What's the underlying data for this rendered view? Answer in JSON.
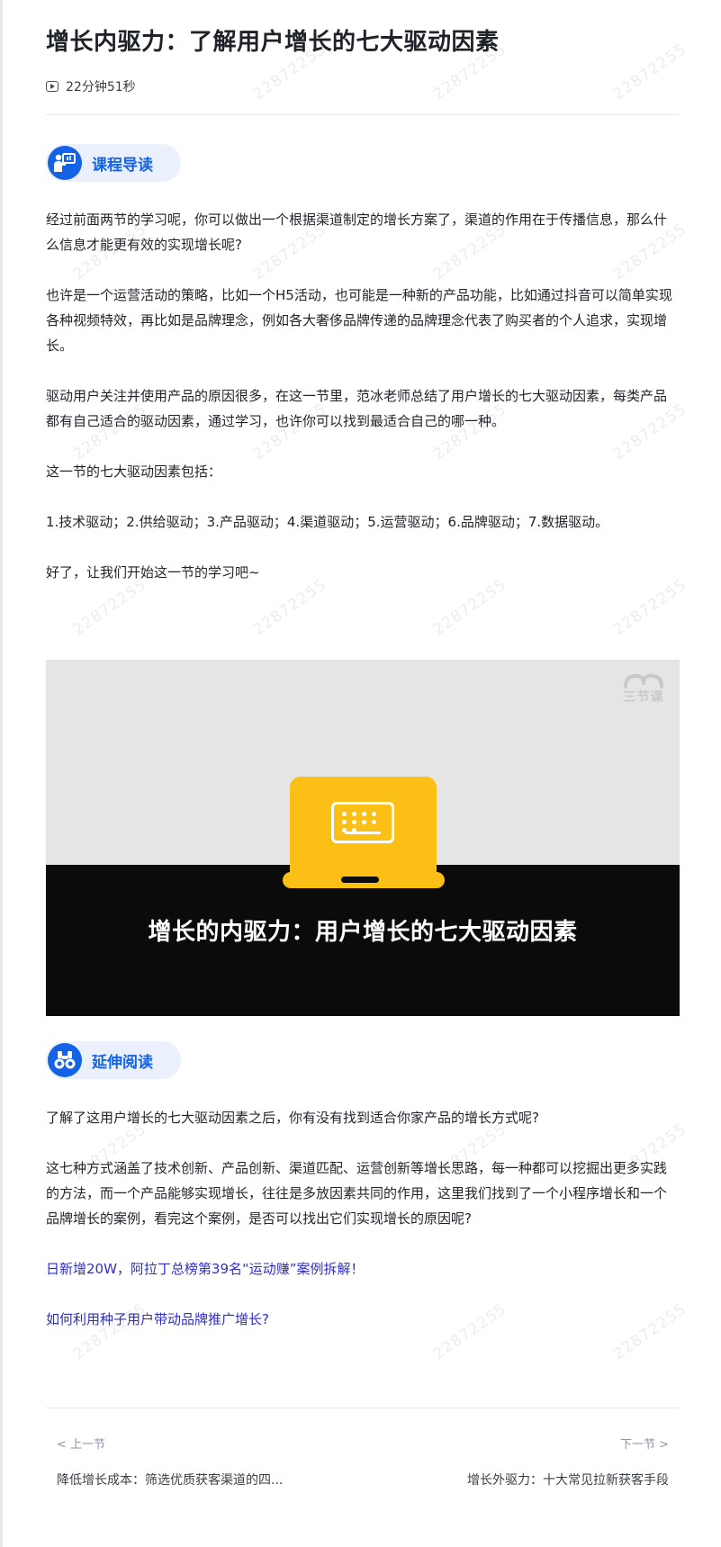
{
  "watermark_text": "22872255",
  "header": {
    "title": "增长内驱力：了解用户增长的七大驱动因素",
    "duration": "22分钟51秒"
  },
  "course_guide": {
    "label": "课程导读",
    "paragraphs": [
      "经过前面两节的学习呢，你可以做出一个根据渠道制定的增长方案了，渠道的作用在于传播信息，那么什么信息才能更有效的实现增长呢?",
      "也许是一个运营活动的策略，比如一个H5活动，也可能是一种新的产品功能，比如通过抖音可以简单实现各种视频特效，再比如是品牌理念，例如各大奢侈品牌传递的品牌理念代表了购买者的个人追求，实现增长。",
      "驱动用户关注并使用产品的原因很多，在这一节里，范冰老师总结了用户增长的七大驱动因素，每类产品都有自己适合的驱动因素，通过学习，也许你可以找到最适合自己的哪一种。",
      "这一节的七大驱动因素包括：",
      "1.技术驱动；2.供给驱动；3.产品驱动；4.渠道驱动；5.运营驱动；6.品牌驱动；7.数据驱动。",
      "好了，让我们开始这一节的学习吧~"
    ]
  },
  "video": {
    "title": "增长的内驱力：用户增长的七大驱动因素",
    "logo_text": "三节课"
  },
  "extended_reading": {
    "label": "延伸阅读",
    "paragraphs": [
      "了解了这用户增长的七大驱动因素之后，你有没有找到适合你家产品的增长方式呢?",
      "这七种方式涵盖了技术创新、产品创新、渠道匹配、运营创新等增长思路，每一种都可以挖掘出更多实践的方法，而一个产品能够实现增长，往往是多放因素共同的作用，这里我们找到了一个小程序增长和一个品牌增长的案例，看完这个案例，是否可以找出它们实现增长的原因呢?"
    ],
    "links": [
      "日新增20W，阿拉丁总榜第39名“运动赚”案例拆解！",
      "如何利用种子用户带动品牌推广增长?"
    ]
  },
  "pager": {
    "prev_label": "< 上一节",
    "prev_title": "降低增长成本：筛选优质获客渠道的四...",
    "next_label": "下一节 >",
    "next_title": "增长外驱力：十大常见拉新获客手段"
  },
  "colors": {
    "accent": "#1463e6",
    "pill_bg": "#eaf1fd",
    "link": "#2f2fc7",
    "video_yellow": "#fbbf16"
  }
}
